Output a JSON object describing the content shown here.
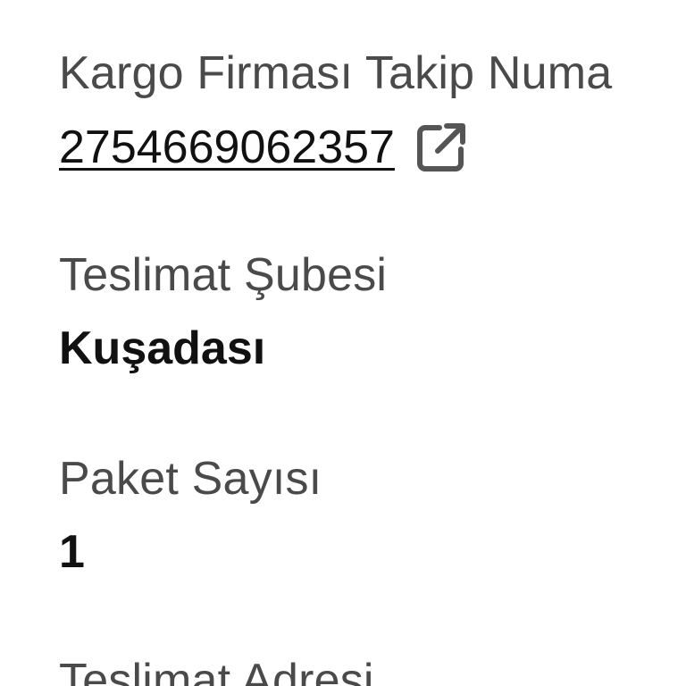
{
  "shipment": {
    "carrier_tracking_label": "Kargo Firması Takip Numa",
    "tracking_number": "2754669062357",
    "tracking_icon": "external-link-icon",
    "delivery_branch_label": "Teslimat Şubesi",
    "delivery_branch_value": "Kuşadası",
    "package_count_label": "Paket Sayısı",
    "package_count_value": "1",
    "delivery_address_label": "Teslimat Adresi"
  }
}
